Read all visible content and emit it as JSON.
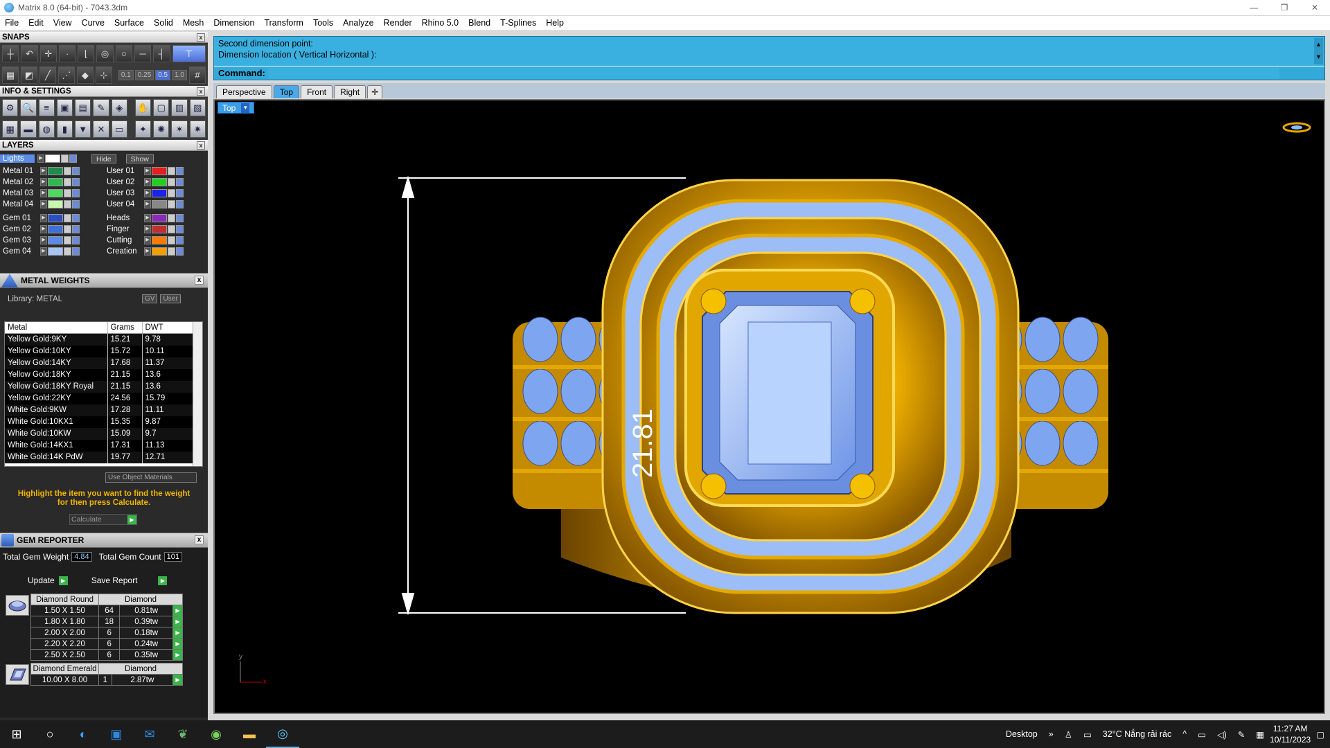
{
  "window": {
    "title": "Matrix 8.0 (64-bit) - 7043.3dm",
    "controls": [
      "—",
      "❐",
      "✕"
    ]
  },
  "menu": [
    "File",
    "Edit",
    "View",
    "Curve",
    "Surface",
    "Solid",
    "Mesh",
    "Dimension",
    "Transform",
    "Tools",
    "Analyze",
    "Render",
    "Rhino 5.0",
    "Blend",
    "T-Splines",
    "Help"
  ],
  "snaps": {
    "title": "SNAPS",
    "values": [
      "0.1",
      "0.25",
      "0.5",
      "1.0"
    ]
  },
  "info": {
    "title": "INFO & SETTINGS"
  },
  "layers": {
    "title": "LAYERS",
    "lights_label": "Lights",
    "hide_label": "Hide",
    "show_label": "Show",
    "left": [
      {
        "name": "Metal 01",
        "color": "#1f8a4a"
      },
      {
        "name": "Metal 02",
        "color": "#2fb84f"
      },
      {
        "name": "Metal 03",
        "color": "#4fd860"
      },
      {
        "name": "Metal 04",
        "color": "#c8f7b0"
      },
      {
        "name": "Gem 01",
        "color": "#2c4fbf"
      },
      {
        "name": "Gem 02",
        "color": "#3f6fd8"
      },
      {
        "name": "Gem 03",
        "color": "#5a8be8"
      },
      {
        "name": "Gem 04",
        "color": "#a7c4f6"
      }
    ],
    "right": [
      {
        "name": "User 01",
        "color": "#e02020"
      },
      {
        "name": "User 02",
        "color": "#20d020"
      },
      {
        "name": "User 03",
        "color": "#1a24e6"
      },
      {
        "name": "User 04",
        "color": "#888888"
      },
      {
        "name": "Heads",
        "color": "#8a2ab8"
      },
      {
        "name": "Finger",
        "color": "#c03030"
      },
      {
        "name": "Cutting",
        "color": "#ff7a00"
      },
      {
        "name": "Creation",
        "color": "#f0a000"
      }
    ]
  },
  "metal_weights": {
    "title": "METAL WEIGHTS",
    "library": "Library: METAL",
    "gv": "GV",
    "user": "User",
    "columns": [
      "Metal",
      "Grams",
      "DWT"
    ],
    "rows": [
      [
        "Yellow Gold:9KY",
        "15.21",
        "9.78"
      ],
      [
        "Yellow Gold:10KY",
        "15.72",
        "10.11"
      ],
      [
        "Yellow Gold:14KY",
        "17.68",
        "11.37"
      ],
      [
        "Yellow Gold:18KY",
        "21.15",
        "13.6"
      ],
      [
        "Yellow Gold:18KY Royal",
        "21.15",
        "13.6"
      ],
      [
        "Yellow Gold:22KY",
        "24.56",
        "15.79"
      ],
      [
        "White Gold:9KW",
        "17.28",
        "11.11"
      ],
      [
        "White Gold:10KX1",
        "15.35",
        "9.87"
      ],
      [
        "White Gold:10KW",
        "15.09",
        "9.7"
      ],
      [
        "White Gold:14KX1",
        "17.31",
        "11.13"
      ],
      [
        "White Gold:14K PdW",
        "19.77",
        "12.71"
      ]
    ],
    "use_object_materials": "Use Object Materials",
    "highlight_text_1": "Highlight the item you want to find the weight",
    "highlight_text_2": "for then press Calculate.",
    "calculate_label": "Calculate"
  },
  "gem_reporter": {
    "title": "GEM REPORTER",
    "total_weight_label": "Total Gem Weight",
    "total_weight_value": "4.84",
    "total_count_label": "Total Gem Count",
    "total_count_value": "101",
    "update_label": "Update",
    "save_label": "Save Report",
    "groups": [
      {
        "shape": "Diamond Round",
        "material": "Diamond",
        "rows": [
          [
            "1.50 X 1.50",
            "64",
            "0.81tw"
          ],
          [
            "1.80 X 1.80",
            "18",
            "0.39tw"
          ],
          [
            "2.00 X 2.00",
            "6",
            "0.18tw"
          ],
          [
            "2.20 X 2.20",
            "6",
            "0.24tw"
          ],
          [
            "2.50 X 2.50",
            "6",
            "0.35tw"
          ]
        ]
      },
      {
        "shape": "Diamond Emerald",
        "material": "Diamond",
        "rows": [
          [
            "10.00 X 8.00",
            "1",
            "2.87tw"
          ]
        ]
      }
    ]
  },
  "command": {
    "history": [
      "Second dimension point:",
      "Dimension location ( Vertical  Horizontal ):"
    ],
    "prompt": "Command:"
  },
  "viewport_tabs": [
    "Perspective",
    "Top",
    "Front",
    "Right"
  ],
  "active_tab": "Top",
  "viewport": {
    "label": "Top",
    "dimension": "21.81",
    "axis_x": "x",
    "axis_y": "y"
  },
  "taskbar": {
    "desktop": "Desktop",
    "weather": "32°C  Nắng rải rác",
    "time": "11:27 AM",
    "date": "10/11/2023"
  },
  "colors": {
    "command_bg": "#3ab0e0",
    "gold": "#e6a800",
    "gem": "#8fb8ff"
  }
}
